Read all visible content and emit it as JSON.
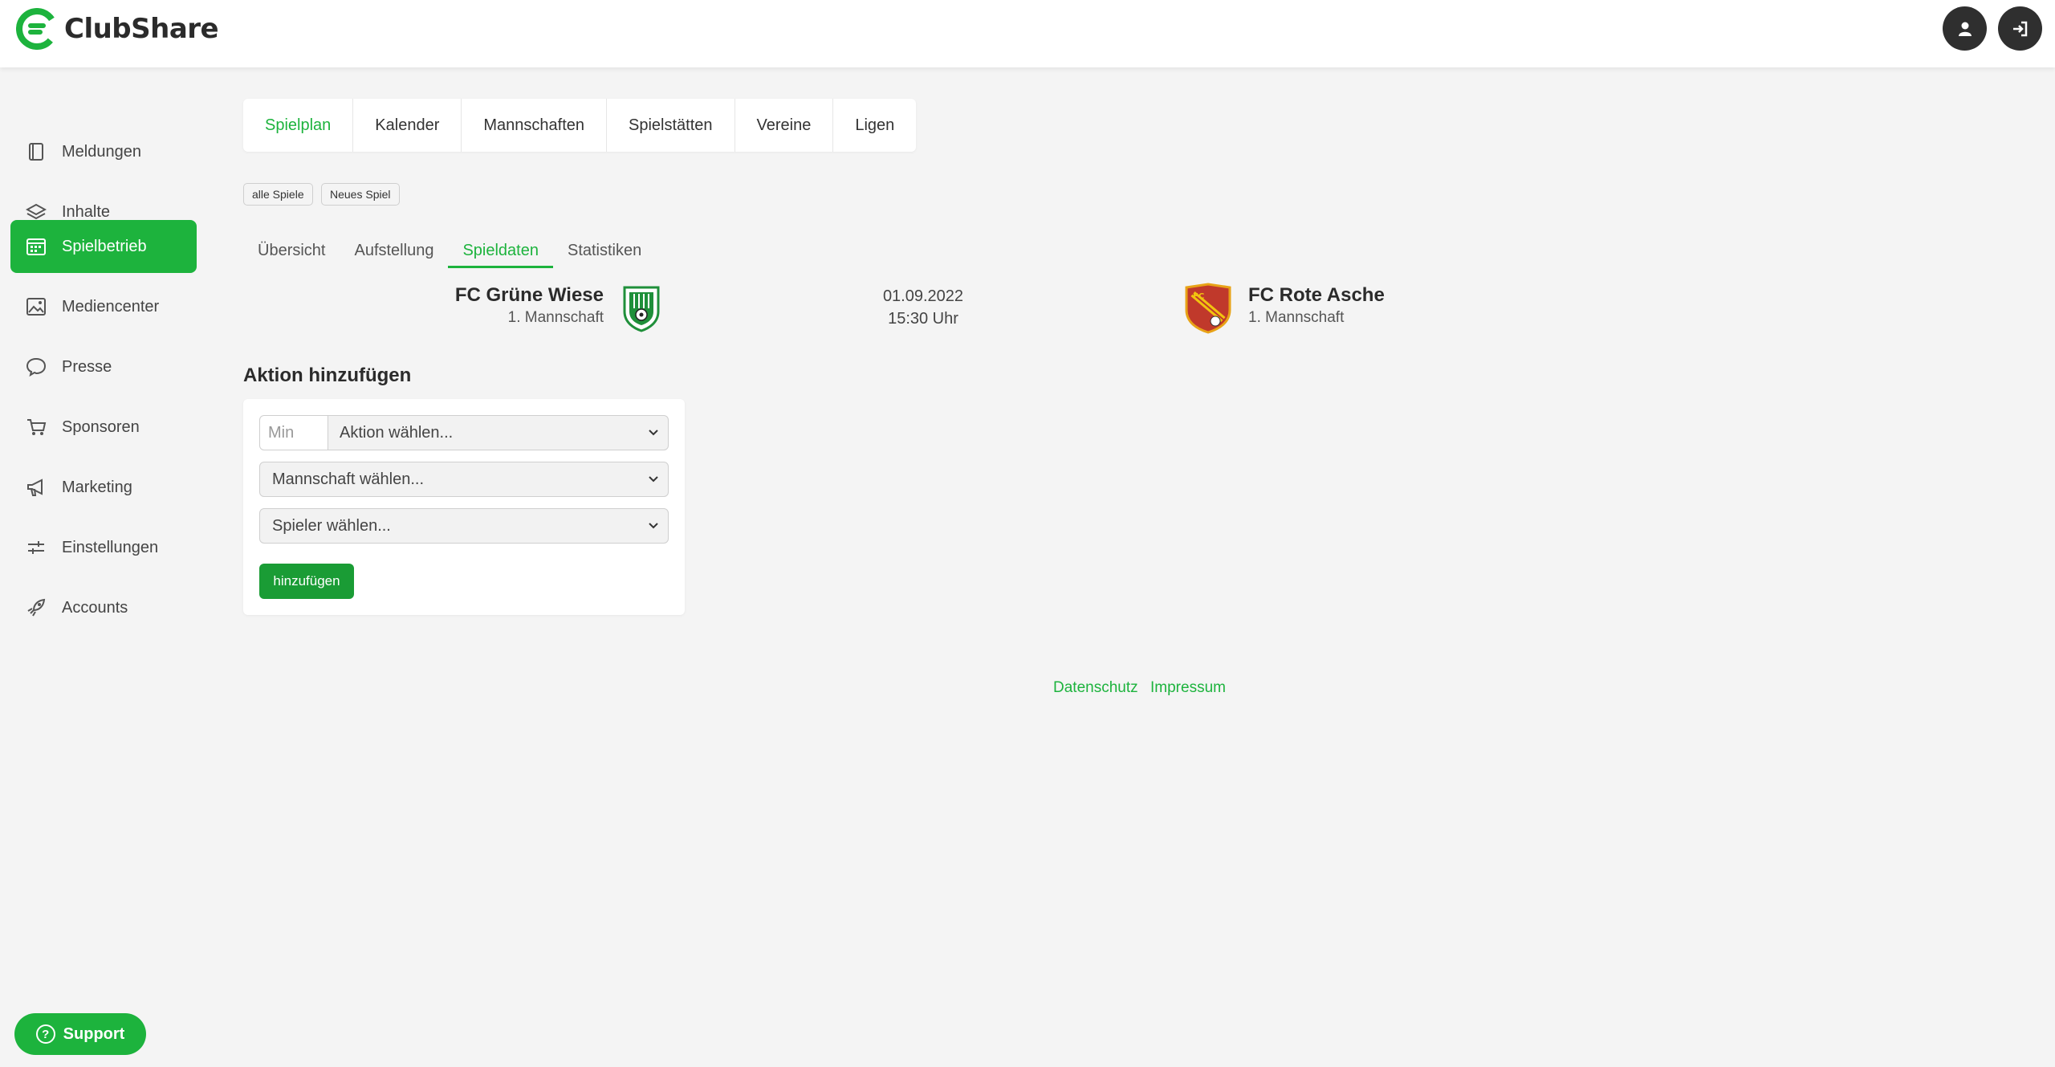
{
  "app": {
    "name": "ClubShare"
  },
  "header": {
    "profile_icon": "user-icon",
    "logout_icon": "logout-icon"
  },
  "sidebar": {
    "items": [
      {
        "label": "Meldungen",
        "icon": "book-icon"
      },
      {
        "label": "Inhalte",
        "icon": "layers-icon"
      },
      {
        "label": "Spielbetrieb",
        "icon": "calendar-icon",
        "active": true
      },
      {
        "label": "Mediencenter",
        "icon": "image-icon"
      },
      {
        "label": "Presse",
        "icon": "chat-icon"
      },
      {
        "label": "Sponsoren",
        "icon": "cart-icon"
      },
      {
        "label": "Marketing",
        "icon": "megaphone-icon"
      },
      {
        "label": "Einstellungen",
        "icon": "sliders-icon"
      },
      {
        "label": "Accounts",
        "icon": "rocket-icon"
      }
    ],
    "support_label": "Support",
    "support_glyph": "?"
  },
  "tabs": [
    "Spielplan",
    "Kalender",
    "Mannschaften",
    "Spielstätten",
    "Vereine",
    "Ligen"
  ],
  "actions": {
    "all_games": "alle Spiele",
    "new_game": "Neues Spiel"
  },
  "subtabs": [
    "Übersicht",
    "Aufstellung",
    "Spieldaten",
    "Statistiken"
  ],
  "match": {
    "home": {
      "name": "FC Grüne Wiese",
      "team": "1. Mannschaft"
    },
    "away": {
      "name": "FC Rote Asche",
      "team": "1. Mannschaft"
    },
    "date": "01.09.2022",
    "time": "15:30 Uhr"
  },
  "form": {
    "title": "Aktion hinzufügen",
    "min_placeholder": "Min",
    "action_select": "Aktion wählen...",
    "team_select": "Mannschaft wählen...",
    "player_select": "Spieler wählen...",
    "submit": "hinzufügen"
  },
  "footer": {
    "privacy": "Datenschutz",
    "imprint": "Impressum"
  },
  "colors": {
    "accent": "#1db33d",
    "dark": "#2f2f2f"
  }
}
